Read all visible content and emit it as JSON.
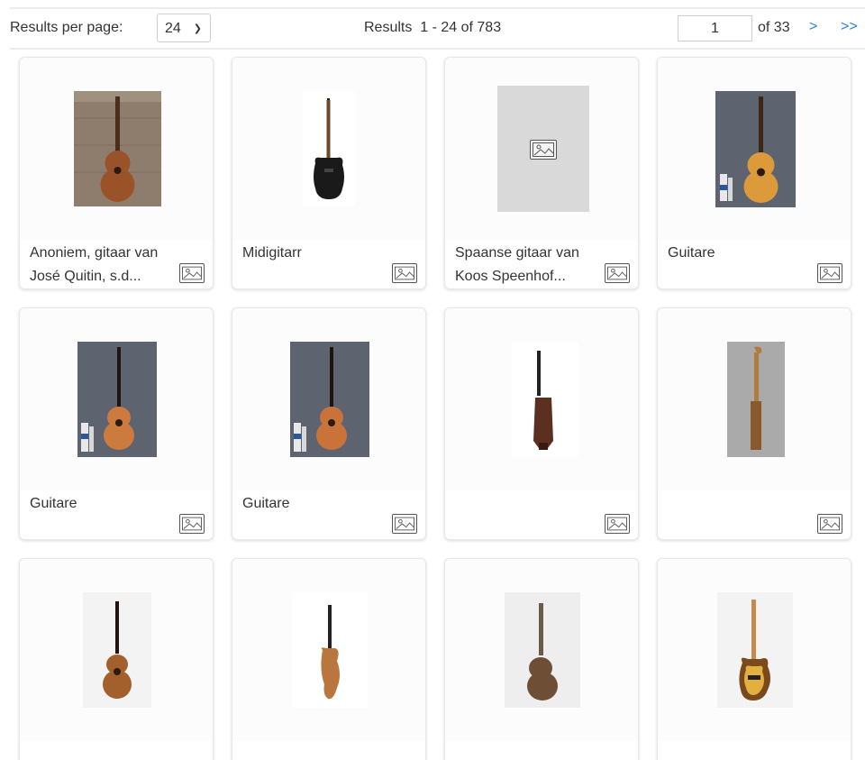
{
  "toolbar": {
    "results_per_page_label": "Results per page:",
    "results_per_page_value": "24",
    "results_summary": "Results  1 - 24 of 783",
    "page_input_value": "1",
    "page_total": "of 33",
    "next_label": ">",
    "last_label": ">>"
  },
  "items": [
    {
      "caption": "Anoniem, gitaar van\nJosé Quitin, s.d...",
      "image": "classical-guitar-against-wall"
    },
    {
      "caption": "Midigitarr",
      "image": "black-electric-guitar"
    },
    {
      "caption": "Spaanse gitaar van\nKoos Speenhof...",
      "image": "no-image-placeholder"
    },
    {
      "caption": "Guitare",
      "image": "baroque-guitar-grey-backdrop"
    },
    {
      "caption": "Guitare",
      "image": "classical-guitar-grey-backdrop"
    },
    {
      "caption": "Guitare",
      "image": "classical-guitar-grey-backdrop"
    },
    {
      "caption": "",
      "image": "guitar-side-view"
    },
    {
      "caption": "",
      "image": "guitar-side-profile-grey"
    },
    {
      "caption": "",
      "image": "small-guitar-front"
    },
    {
      "caption": "",
      "image": "guitar-side-view-natural"
    },
    {
      "caption": "",
      "image": "guitar-back-view"
    },
    {
      "caption": "",
      "image": "sunburst-electric-bass"
    }
  ],
  "colors": {
    "link": "#2a7fd4",
    "card_bg": "#fafafa",
    "placeholder": "#d9d9d9"
  }
}
